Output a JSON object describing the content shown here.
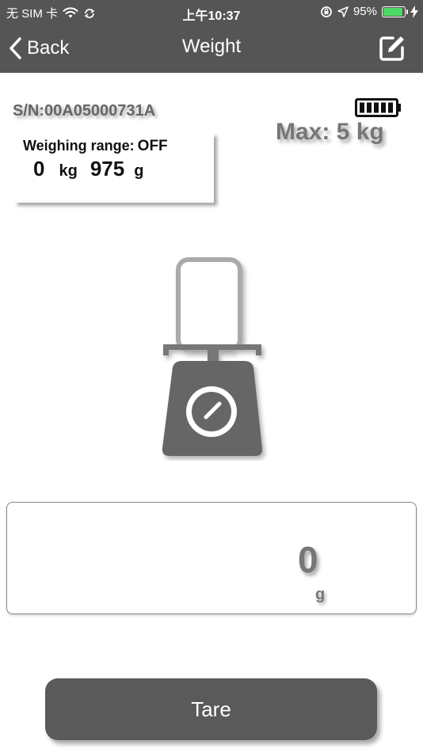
{
  "status_bar": {
    "carrier": "无 SIM 卡",
    "time": "上午10:37",
    "battery_percent": "95%",
    "battery_level": 0.95,
    "icons": [
      "wifi-icon",
      "sync-icon",
      "orientation-lock-icon",
      "location-arrow-icon",
      "charging-bolt-icon"
    ]
  },
  "navbar": {
    "back_label": "Back",
    "title": "Weight",
    "edit_icon": "edit-icon"
  },
  "device": {
    "serial": "S/N:00A05000731A",
    "max_capacity": "Max: 5 kg",
    "battery_icon": "device-battery-icon"
  },
  "range": {
    "label": "Weighing range:",
    "state": "OFF",
    "kg_value": "0",
    "kg_unit": "kg",
    "g_value": "975",
    "g_unit": "g"
  },
  "reading": {
    "value": "0",
    "unit": "g"
  },
  "actions": {
    "tare_label": "Tare"
  },
  "colors": {
    "bar": "#555555",
    "accent_battery": "#4cd964",
    "text_gray": "#777777"
  }
}
